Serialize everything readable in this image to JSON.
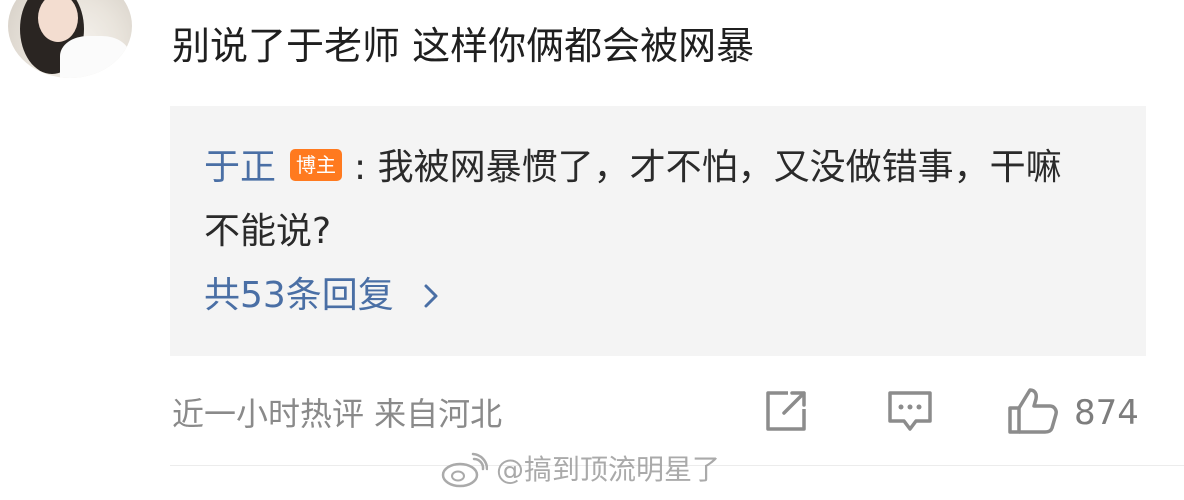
{
  "comment": {
    "text": "别说了于老师 这样你俩都会被网暴"
  },
  "reply": {
    "author": "于正",
    "badge": "博主",
    "colon": ":",
    "text": "我被网暴惯了，才不怕，又没做错事，干嘛不能说?",
    "more_replies": "共53条回复"
  },
  "meta": {
    "text": "近一小时热评  来自河北"
  },
  "actions": {
    "like_count": "874"
  },
  "watermark": {
    "text": "@搞到顶流明星了"
  },
  "colors": {
    "link_blue": "#4a6fa5",
    "badge_orange": "#ff7a1f",
    "card_bg": "#f4f4f4",
    "icon_gray": "#8c8c8c"
  },
  "icons": [
    "avatar",
    "chevron-right-icon",
    "share-icon",
    "comment-icon",
    "like-icon",
    "weibo-logo-icon"
  ]
}
